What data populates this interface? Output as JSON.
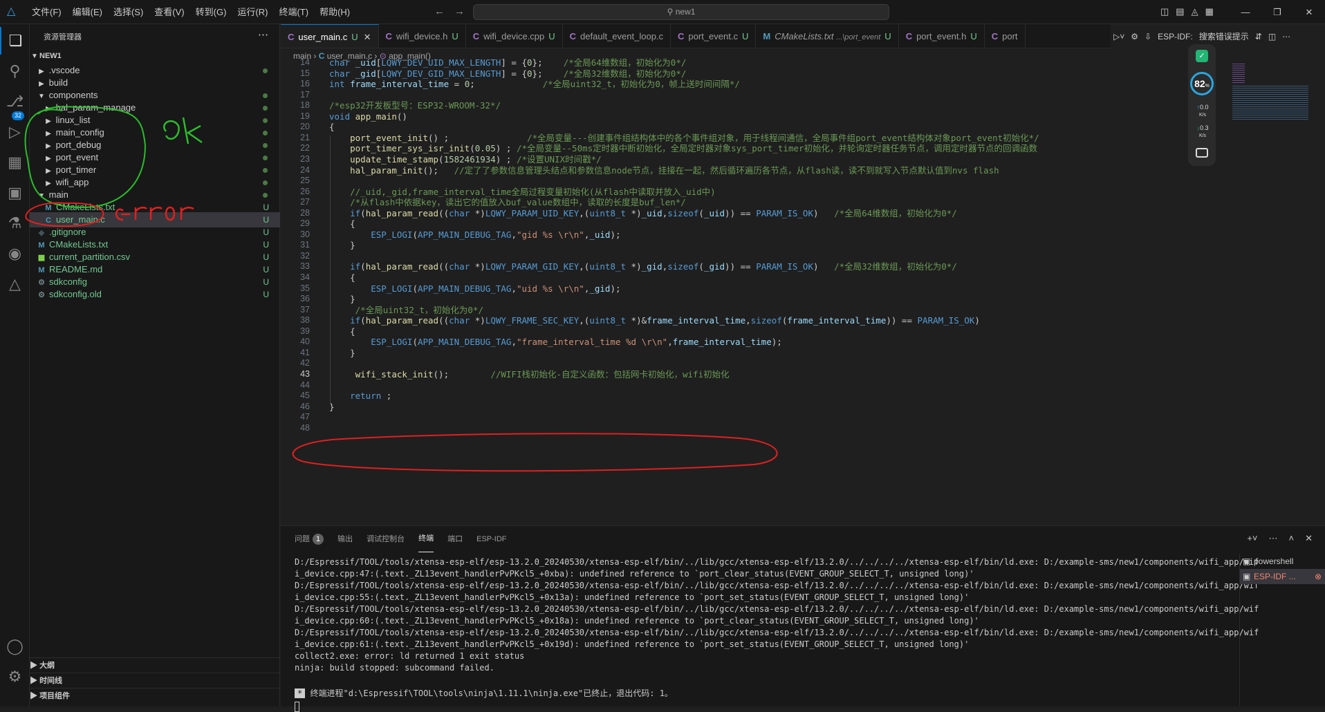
{
  "titlebar": {
    "menus": [
      "文件(F)",
      "编辑(E)",
      "选择(S)",
      "查看(V)",
      "转到(G)",
      "运行(R)",
      "终端(T)",
      "帮助(H)"
    ],
    "search": "new1"
  },
  "activity": {
    "scm_badge": "32"
  },
  "sidebar": {
    "title": "资源管理器",
    "root": "NEW1",
    "items": [
      {
        "label": ".vscode",
        "kind": "folder",
        "depth": 1,
        "open": false,
        "status": "dot"
      },
      {
        "label": "build",
        "kind": "folder",
        "depth": 1,
        "open": false,
        "status": ""
      },
      {
        "label": "components",
        "kind": "folder",
        "depth": 1,
        "open": true,
        "status": "dot"
      },
      {
        "label": "hal_param_manage",
        "kind": "folder",
        "depth": 2,
        "open": false,
        "status": "dot"
      },
      {
        "label": "linux_list",
        "kind": "folder",
        "depth": 2,
        "open": false,
        "status": "dot"
      },
      {
        "label": "main_config",
        "kind": "folder",
        "depth": 2,
        "open": false,
        "status": "dot"
      },
      {
        "label": "port_debug",
        "kind": "folder",
        "depth": 2,
        "open": false,
        "status": "dot"
      },
      {
        "label": "port_event",
        "kind": "folder",
        "depth": 2,
        "open": false,
        "status": "dot"
      },
      {
        "label": "port_timer",
        "kind": "folder",
        "depth": 2,
        "open": false,
        "status": "dot"
      },
      {
        "label": "wifi_app",
        "kind": "folder",
        "depth": 2,
        "open": false,
        "status": "dot"
      },
      {
        "label": "main",
        "kind": "folder",
        "depth": 1,
        "open": true,
        "status": "dot"
      },
      {
        "label": "CMakeLists.txt",
        "kind": "cmake",
        "depth": 2,
        "status": "U"
      },
      {
        "label": "user_main.c",
        "kind": "c",
        "depth": 2,
        "status": "U",
        "selected": true
      },
      {
        "label": ".gitignore",
        "kind": "git",
        "depth": 1,
        "status": "U"
      },
      {
        "label": "CMakeLists.txt",
        "kind": "cmake",
        "depth": 1,
        "status": "U"
      },
      {
        "label": "current_partition.csv",
        "kind": "csv",
        "depth": 1,
        "status": "U"
      },
      {
        "label": "README.md",
        "kind": "md",
        "depth": 1,
        "status": "U"
      },
      {
        "label": "sdkconfig",
        "kind": "cfg",
        "depth": 1,
        "status": "U"
      },
      {
        "label": "sdkconfig.old",
        "kind": "cfg",
        "depth": 1,
        "status": "U"
      }
    ],
    "footer": [
      "大纲",
      "时间线",
      "项目组件"
    ]
  },
  "tabs": [
    {
      "icon": "C",
      "label": "user_main.c",
      "status": "U",
      "active": true
    },
    {
      "icon": "C",
      "label": "wifi_device.h",
      "status": "U"
    },
    {
      "icon": "C",
      "label": "wifi_device.cpp",
      "status": "U"
    },
    {
      "icon": "C",
      "label": "default_event_loop.c",
      "status": ""
    },
    {
      "icon": "C",
      "label": "port_event.c",
      "status": "U"
    },
    {
      "icon": "M",
      "label": "CMakeLists.txt",
      "extra": "...\\port_event",
      "status": "U"
    },
    {
      "icon": "C",
      "label": "port_event.h",
      "status": "U"
    },
    {
      "icon": "C",
      "label": "port",
      "status": ""
    }
  ],
  "editor_actions": {
    "idf_label": "ESP-IDF:",
    "search_label": "搜索错误提示"
  },
  "breadcrumb": {
    "folder": "main",
    "file": "user_main.c",
    "symbol": "app_main()"
  },
  "code": {
    "current_line": 43,
    "lines": [
      {
        "n": "14",
        "t": "char _uid[LQWY_DEV_UID_MAX_LENGTH] = {0};    /*全局64维数组，初始化为0*/"
      },
      {
        "n": "15",
        "t": "char _gid[LQWY_DEV_GID_MAX_LENGTH] = {0};    /*全局32维数组，初始化为0*/"
      },
      {
        "n": "16",
        "t": "int frame_interval_time = 0;             /*全局uint32_t，初始化为0，帧上送时间间隔*/"
      },
      {
        "n": "17",
        "t": ""
      },
      {
        "n": "18",
        "t": "/*esp32开发板型号：ESP32-WROOM-32*/"
      },
      {
        "n": "19",
        "t": "void app_main()"
      },
      {
        "n": "20",
        "t": "{"
      },
      {
        "n": "21",
        "t": "    port_event_init() ;               /*全局变量---创建事件组结构体中的各个事件组对象，用于线程间通信，全局事件组port_event结构体对象port_event初始化*/"
      },
      {
        "n": "22",
        "t": "    port_timer_sys_isr_init(0.05) ; /*全局变量--50ms定时器中断初始化，全局定时器对象sys_port_timer初始化，并轮询定时器任务节点，调用定时器节点的回调函数"
      },
      {
        "n": "23",
        "t": "    update_time_stamp(1582461934) ; /*设置UNIX时间戳*/"
      },
      {
        "n": "24",
        "t": "    hal_param_init();   //定了了参数信息管理头结点和参数信息node节点，挂接在一起，然后循环遍历各节点，从flash读，读不到就写入节点默认值到nvs flash"
      },
      {
        "n": "25",
        "t": ""
      },
      {
        "n": "26",
        "t": "    //_uid,_gid,frame_interval_time全局过程变量初始化(从flash中读取并放入_uid中)"
      },
      {
        "n": "27",
        "t": "    /*从flash中依据key，读出它的值放入buf_value数组中，读取的长度是buf_len*/"
      },
      {
        "n": "28",
        "t": "    if(hal_param_read((char *)LQWY_PARAM_UID_KEY,(uint8_t *)_uid,sizeof(_uid)) == PARAM_IS_OK)   /*全局64维数组，初始化为0*/"
      },
      {
        "n": "29",
        "t": "    {"
      },
      {
        "n": "30",
        "t": "        ESP_LOGI(APP_MAIN_DEBUG_TAG,\"gid %s \\r\\n\",_uid);"
      },
      {
        "n": "31",
        "t": "    }"
      },
      {
        "n": "32",
        "t": ""
      },
      {
        "n": "33",
        "t": "    if(hal_param_read((char *)LQWY_PARAM_GID_KEY,(uint8_t *)_gid,sizeof(_gid)) == PARAM_IS_OK)   /*全局32维数组，初始化为0*/"
      },
      {
        "n": "34",
        "t": "    {"
      },
      {
        "n": "35",
        "t": "        ESP_LOGI(APP_MAIN_DEBUG_TAG,\"uid %s \\r\\n\",_gid);"
      },
      {
        "n": "36",
        "t": "    }"
      },
      {
        "n": "37",
        "t": "     /*全局uint32_t，初始化为0*/"
      },
      {
        "n": "38",
        "t": "    if(hal_param_read((char *)LQWY_FRAME_SEC_KEY,(uint8_t *)&frame_interval_time,sizeof(frame_interval_time)) == PARAM_IS_OK)"
      },
      {
        "n": "39",
        "t": "    {"
      },
      {
        "n": "40",
        "t": "        ESP_LOGI(APP_MAIN_DEBUG_TAG,\"frame_interval_time %d \\r\\n\",frame_interval_time);"
      },
      {
        "n": "41",
        "t": "    }"
      },
      {
        "n": "42",
        "t": ""
      },
      {
        "n": "43",
        "t": "     wifi_stack_init();        //WIFI栈初始化-自定义函数：包括网卡初始化，wifi初始化"
      },
      {
        "n": "44",
        "t": ""
      },
      {
        "n": "45",
        "t": "    return ;"
      },
      {
        "n": "46",
        "t": "}"
      },
      {
        "n": "47",
        "t": ""
      },
      {
        "n": "48",
        "t": ""
      }
    ]
  },
  "widget": {
    "percent": "82",
    "unit": "%",
    "up": "0.0",
    "down": "0.3",
    "rate_unit": "K/s"
  },
  "panel": {
    "tabs": [
      {
        "label": "问题",
        "count": "1"
      },
      {
        "label": "输出"
      },
      {
        "label": "调试控制台"
      },
      {
        "label": "终端",
        "active": true
      },
      {
        "label": "端口"
      },
      {
        "label": "ESP-IDF"
      }
    ],
    "terminal_lines": [
      "D:/Espressif/TOOL/tools/xtensa-esp-elf/esp-13.2.0_20240530/xtensa-esp-elf/bin/../lib/gcc/xtensa-esp-elf/13.2.0/../../../../xtensa-esp-elf/bin/ld.exe: D:/example-sms/new1/components/wifi_app/wif",
      "i_device.cpp:47:(.text._ZL13event_handlerPvPKcl5_+0xba): undefined reference to `port_clear_status(EVENT_GROUP_SELECT_T, unsigned long)'",
      "D:/Espressif/TOOL/tools/xtensa-esp-elf/esp-13.2.0_20240530/xtensa-esp-elf/bin/../lib/gcc/xtensa-esp-elf/13.2.0/../../../../xtensa-esp-elf/bin/ld.exe: D:/example-sms/new1/components/wifi_app/wif",
      "i_device.cpp:55:(.text._ZL13event_handlerPvPKcl5_+0x13a): undefined reference to `port_set_status(EVENT_GROUP_SELECT_T, unsigned long)'",
      "D:/Espressif/TOOL/tools/xtensa-esp-elf/esp-13.2.0_20240530/xtensa-esp-elf/bin/../lib/gcc/xtensa-esp-elf/13.2.0/../../../../xtensa-esp-elf/bin/ld.exe: D:/example-sms/new1/components/wifi_app/wif",
      "i_device.cpp:60:(.text._ZL13event_handlerPvPKcl5_+0x18a): undefined reference to `port_clear_status(EVENT_GROUP_SELECT_T, unsigned long)'",
      "D:/Espressif/TOOL/tools/xtensa-esp-elf/esp-13.2.0_20240530/xtensa-esp-elf/bin/../lib/gcc/xtensa-esp-elf/13.2.0/../../../../xtensa-esp-elf/bin/ld.exe: D:/example-sms/new1/components/wifi_app/wif",
      "i_device.cpp:61:(.text._ZL13event_handlerPvPKcl5_+0x19d): undefined reference to `port_set_status(EVENT_GROUP_SELECT_T, unsigned long)'",
      "collect2.exe: error: ld returned 1 exit status",
      "ninja: build stopped: subcommand failed."
    ],
    "exit_message": "终端进程\"d:\\Espressif\\TOOL\\tools\\ninja\\1.11.1\\ninja.exe\"已终止，退出代码: 1。",
    "terminals": [
      {
        "label": "powershell"
      },
      {
        "label": "ESP-IDF ...",
        "active": true
      }
    ]
  },
  "annotations": {
    "ok": "ok",
    "error": "error"
  }
}
